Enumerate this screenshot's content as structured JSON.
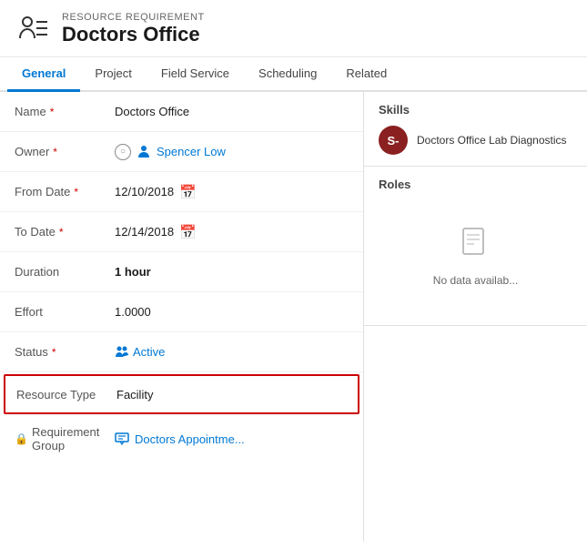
{
  "header": {
    "subtitle": "RESOURCE REQUIREMENT",
    "title": "Doctors Office"
  },
  "tabs": [
    {
      "label": "General",
      "active": true
    },
    {
      "label": "Project",
      "active": false
    },
    {
      "label": "Field Service",
      "active": false
    },
    {
      "label": "Scheduling",
      "active": false
    },
    {
      "label": "Related",
      "active": false
    }
  ],
  "form": {
    "fields": [
      {
        "label": "Name",
        "required": true,
        "value": "Doctors Office",
        "type": "text"
      },
      {
        "label": "Owner",
        "required": true,
        "value": "Spencer Low",
        "type": "owner"
      },
      {
        "label": "From Date",
        "required": true,
        "value": "12/10/2018",
        "type": "date"
      },
      {
        "label": "To Date",
        "required": true,
        "value": "12/14/2018",
        "type": "date"
      },
      {
        "label": "Duration",
        "required": false,
        "value": "1 hour",
        "type": "text-bold"
      },
      {
        "label": "Effort",
        "required": false,
        "value": "1.0000",
        "type": "text"
      },
      {
        "label": "Status",
        "required": true,
        "value": "Active",
        "type": "status"
      },
      {
        "label": "Resource Type",
        "required": false,
        "value": "Facility",
        "type": "text",
        "highlighted": true
      }
    ],
    "requirement_group": {
      "label": "Requirement Group",
      "value": "Doctors Appointme...",
      "has_lock": true
    }
  },
  "right_panel": {
    "skills": {
      "title": "Skills",
      "item": {
        "initials": "S-",
        "name": "Doctors Office Lab Diagnostics"
      }
    },
    "roles": {
      "title": "Roles",
      "empty_text": "No data availab..."
    }
  }
}
